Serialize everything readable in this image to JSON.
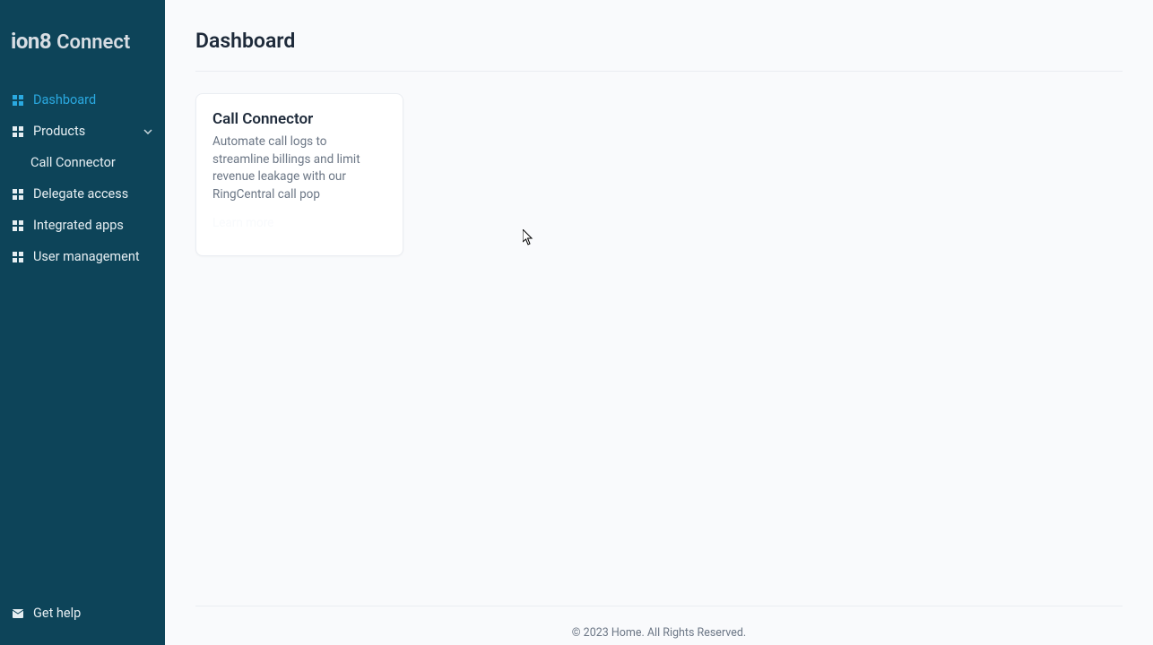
{
  "logo": {
    "brand": "ion8",
    "product": "Connect"
  },
  "sidebar": {
    "items": [
      {
        "label": "Dashboard",
        "active": true
      },
      {
        "label": "Products",
        "expandable": true
      },
      {
        "label": "Delegate access"
      },
      {
        "label": "Integrated apps"
      },
      {
        "label": "User management"
      }
    ],
    "products_children": [
      {
        "label": "Call Connector"
      }
    ],
    "footer": {
      "help_label": "Get help"
    }
  },
  "page": {
    "title": "Dashboard"
  },
  "cards": [
    {
      "title": "Call Connector",
      "description": "Automate call logs to streamline billings and limit revenue leakage with our RingCentral call pop",
      "link_label": "Learn more"
    }
  ],
  "footer": {
    "copyright": "© 2023 Home. All Rights Reserved."
  }
}
